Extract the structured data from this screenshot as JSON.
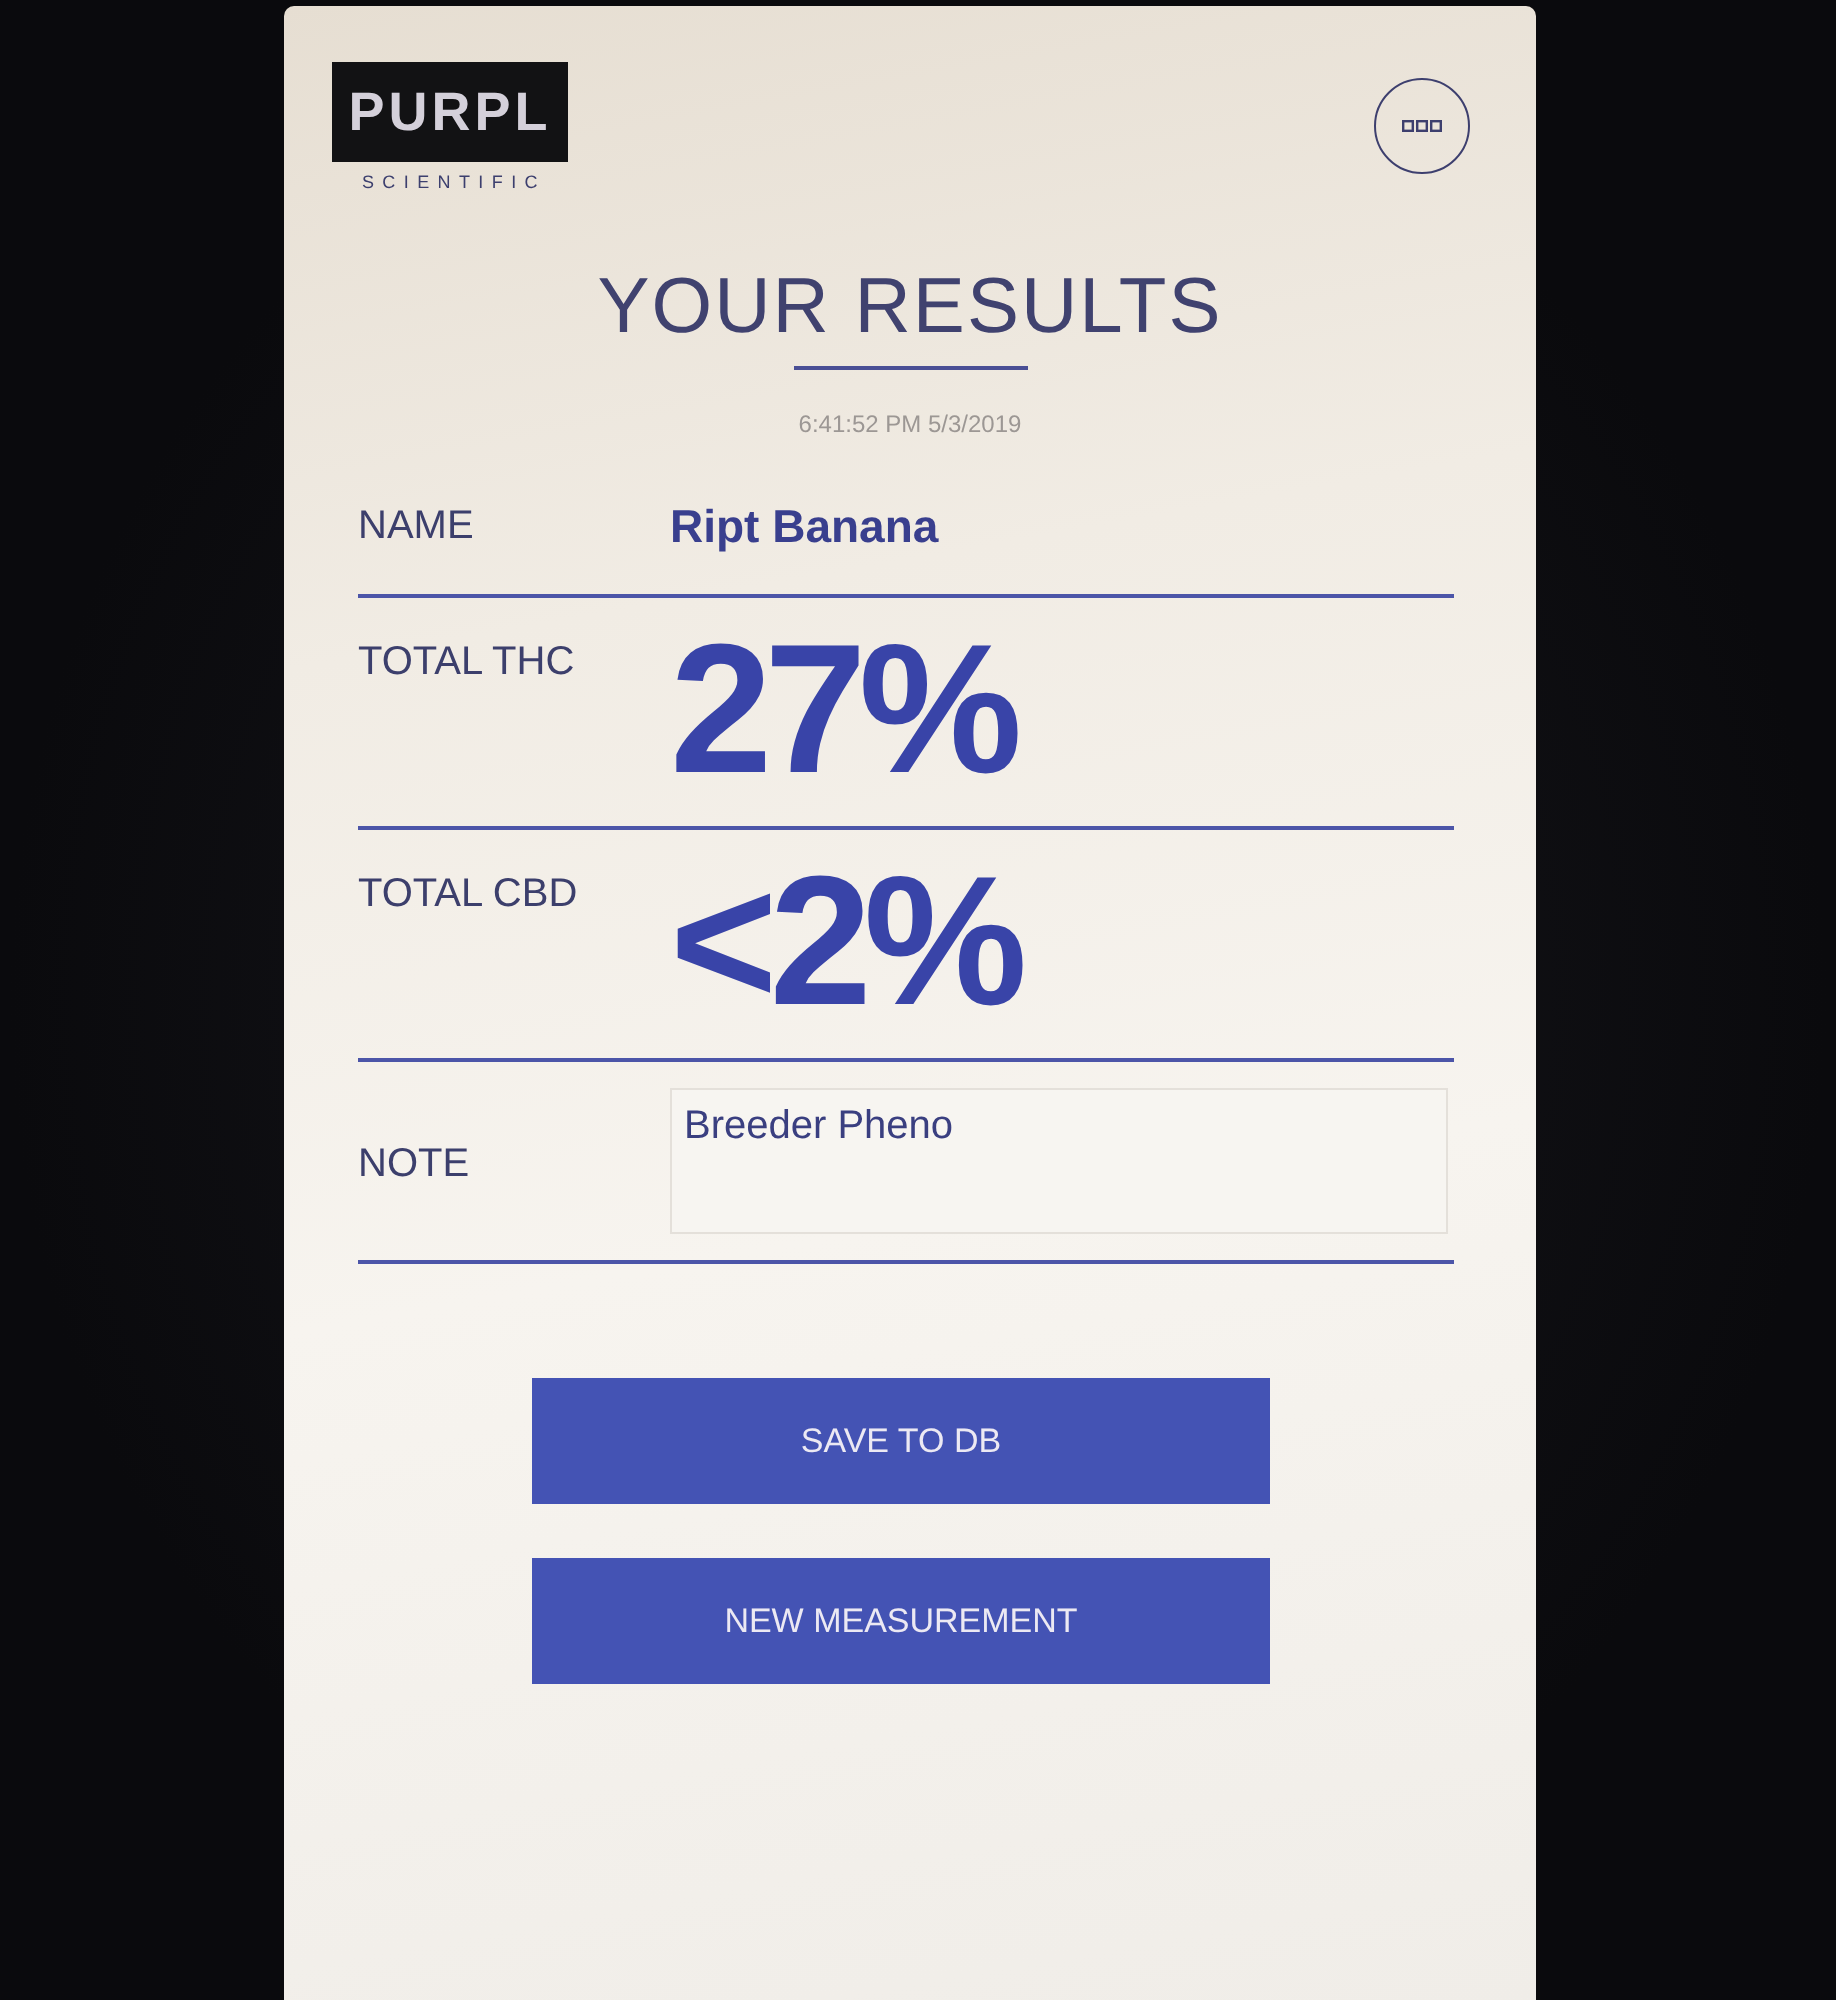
{
  "logo": {
    "wordmark": "PURPL",
    "tagline": "SCIENTIFIC"
  },
  "title": "YOUR RESULTS",
  "timestamp": "6:41:52 PM 5/3/2019",
  "fields": [
    {
      "kind": "text",
      "label": "NAME",
      "value": "Ript Banana"
    },
    {
      "kind": "big",
      "label": "TOTAL THC",
      "value": "27%"
    },
    {
      "kind": "big",
      "label": "TOTAL CBD",
      "value": "<2%"
    },
    {
      "kind": "note",
      "label": "NOTE",
      "value": "Breeder Pheno"
    }
  ],
  "buttons": [
    "SAVE TO DB",
    "NEW MEASUREMENT"
  ]
}
